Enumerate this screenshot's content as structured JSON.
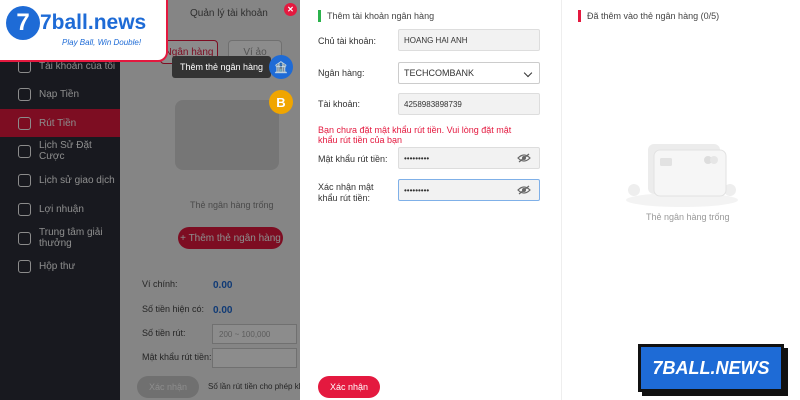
{
  "logo": {
    "text": "7ball.news",
    "badge": "7",
    "slogan": "Play Ball, Win Double!"
  },
  "background": {
    "tab_title": "Quản lý tài khoản",
    "pill_left": "Ngân hàng",
    "pill_right": "Ví ảo",
    "empty_text": "Thẻ ngân hàng trống",
    "add_button": "+ Thêm thẻ ngân hàng",
    "rows": {
      "wallet_label": "Ví chính:",
      "wallet_value": "0.00",
      "balance_label": "Số tiền hiện có:",
      "balance_value": "0.00",
      "withdraw_label": "Số tiền rút:",
      "withdraw_placeholder": "200 ~ 100,000",
      "password_label": "Mật khẩu rút tiền:"
    },
    "submit": "Xác nhận",
    "note": "Số lần rút tiền cho phép khác"
  },
  "sidebar": {
    "items": [
      {
        "label": "Tài khoản của tôi"
      },
      {
        "label": "Nạp Tiền"
      },
      {
        "label": "Rút Tiền",
        "active": true
      },
      {
        "label": "Lịch Sử Đặt Cược"
      },
      {
        "label": "Lịch sử giao dịch"
      },
      {
        "label": "Lợi nhuận"
      },
      {
        "label": "Trung tâm giải thưởng"
      },
      {
        "label": "Hộp thư"
      }
    ]
  },
  "tooltip": "Thêm thẻ ngân hàng",
  "float_coin": "B",
  "form": {
    "header": "Thêm tài khoản ngân hàng",
    "holder_label": "Chủ tài khoản:",
    "holder_value": "HOANG  HAI ANH",
    "bank_label": "Ngân hàng:",
    "bank_value": "TECHCOMBANK",
    "account_label": "Tài khoản:",
    "account_value": "4258983898739",
    "warning": "Bạn chưa đặt mật khẩu rút tiền. Vui lòng đặt mật khẩu rút tiền của bạn",
    "password_label": "Mật khẩu rút tiền:",
    "password_value": "•••••••••",
    "confirm_label": "Xác nhận mật khẩu rút tiền:",
    "confirm_value": "•••••••••",
    "submit": "Xác nhận"
  },
  "saved_cards": {
    "header": "Đã thêm vào thẻ ngân hàng",
    "count": "(0/5)",
    "empty_text": "Thẻ ngân hàng trống"
  },
  "watermark": "7BALL.NEWS",
  "colors": {
    "brand_red": "#e4193f",
    "brand_blue": "#1e6bd6",
    "sidebar": "#2c2f3a"
  }
}
